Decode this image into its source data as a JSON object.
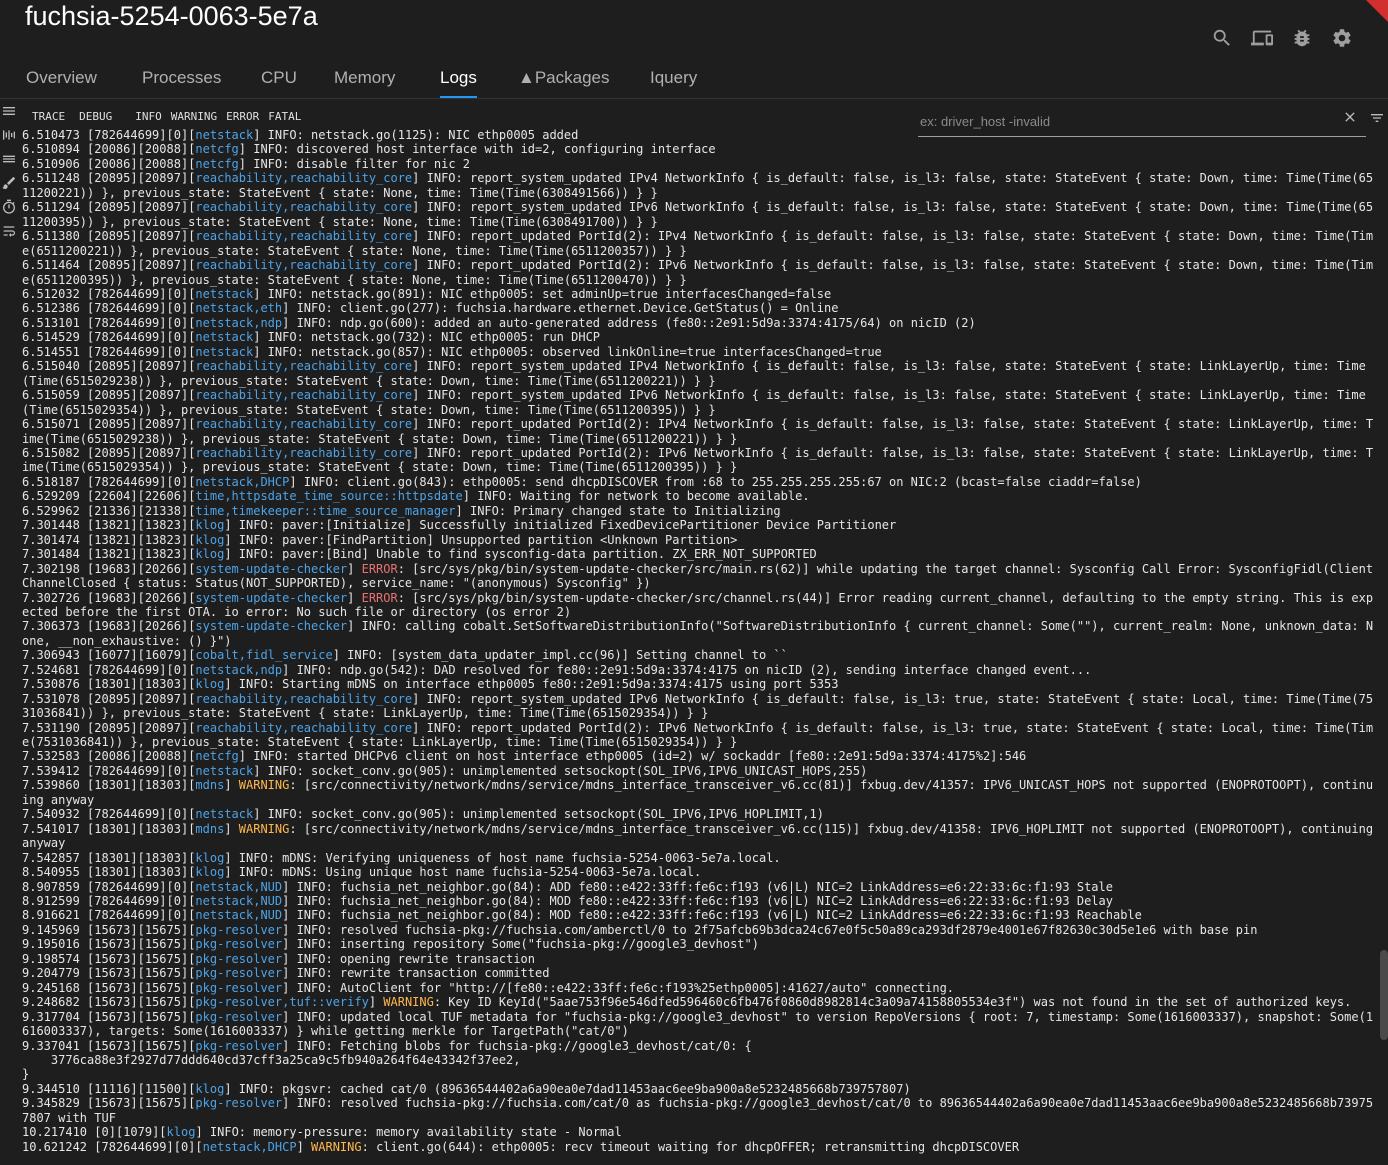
{
  "window": {
    "title": "fuchsia-5254-0063-5e7a"
  },
  "toolbar": {
    "icons": [
      "search-icon",
      "devices-icon",
      "bug-icon",
      "settings-icon"
    ]
  },
  "tabs": [
    {
      "label": "Overview",
      "active": false
    },
    {
      "label": "Processes",
      "active": false
    },
    {
      "label": "CPU",
      "active": false
    },
    {
      "label": "Memory",
      "active": false
    },
    {
      "label": "Logs",
      "active": true
    },
    {
      "label": "Packages",
      "active": false
    },
    {
      "label": "Iquery",
      "active": false
    }
  ],
  "levels": [
    "TRACE",
    "DEBUG",
    "INFO",
    "WARNING",
    "ERROR",
    "FATAL"
  ],
  "filter": {
    "placeholder": "ex: driver_host -invalid",
    "value": ""
  },
  "colors": {
    "tag": "#4da3e8",
    "error": "#e57373",
    "warning": "#ffb74d",
    "accent": "#2196f3"
  },
  "logs": [
    {
      "ts": "6.510473",
      "pid": "[782644699][0]",
      "tags": "netstack",
      "level": "INFO",
      "msg": " netstack.go(1125): NIC ethp0005 added"
    },
    {
      "ts": "6.510894",
      "pid": "[20086][20088]",
      "tags": "netcfg",
      "level": "INFO",
      "msg": " discovered host interface with id=2, configuring interface"
    },
    {
      "ts": "6.510906",
      "pid": "[20086][20088]",
      "tags": "netcfg",
      "level": "INFO",
      "msg": " disable filter for nic 2"
    },
    {
      "ts": "6.511248",
      "pid": "[20895][20897]",
      "tags": "reachability,reachability_core",
      "level": "INFO",
      "msg": " report_system_updated IPv4 NetworkInfo { is_default: false, is_l3: false, state: StateEvent { state: Down, time: Time(Time(6511200221)) }, previous_state: StateEvent { state: None, time: Time(Time(6308491566)) } }"
    },
    {
      "ts": "6.511294",
      "pid": "[20895][20897]",
      "tags": "reachability,reachability_core",
      "level": "INFO",
      "msg": " report_system_updated IPv6 NetworkInfo { is_default: false, is_l3: false, state: StateEvent { state: Down, time: Time(Time(6511200395)) }, previous_state: StateEvent { state: None, time: Time(Time(6308491700)) } }"
    },
    {
      "ts": "6.511380",
      "pid": "[20895][20897]",
      "tags": "reachability,reachability_core",
      "level": "INFO",
      "msg": " report_updated PortId(2): IPv4 NetworkInfo { is_default: false, is_l3: false, state: StateEvent { state: Down, time: Time(Time(6511200221)) }, previous_state: StateEvent { state: None, time: Time(Time(6511200357)) } }"
    },
    {
      "ts": "6.511464",
      "pid": "[20895][20897]",
      "tags": "reachability,reachability_core",
      "level": "INFO",
      "msg": " report_updated PortId(2): IPv6 NetworkInfo { is_default: false, is_l3: false, state: StateEvent { state: Down, time: Time(Time(6511200395)) }, previous_state: StateEvent { state: None, time: Time(Time(6511200470)) } }"
    },
    {
      "ts": "6.512032",
      "pid": "[782644699][0]",
      "tags": "netstack",
      "level": "INFO",
      "msg": " netstack.go(891): NIC ethp0005: set adminUp=true interfacesChanged=false"
    },
    {
      "ts": "6.512386",
      "pid": "[782644699][0]",
      "tags": "netstack,eth",
      "level": "INFO",
      "msg": " client.go(277): fuchsia.hardware.ethernet.Device.GetStatus() = Online"
    },
    {
      "ts": "6.513101",
      "pid": "[782644699][0]",
      "tags": "netstack,ndp",
      "level": "INFO",
      "msg": " ndp.go(600): added an auto-generated address (fe80::2e91:5d9a:3374:4175/64) on nicID (2)"
    },
    {
      "ts": "6.514529",
      "pid": "[782644699][0]",
      "tags": "netstack",
      "level": "INFO",
      "msg": " netstack.go(732): NIC ethp0005: run DHCP"
    },
    {
      "ts": "6.514551",
      "pid": "[782644699][0]",
      "tags": "netstack",
      "level": "INFO",
      "msg": " netstack.go(857): NIC ethp0005: observed linkOnline=true interfacesChanged=true"
    },
    {
      "ts": "6.515040",
      "pid": "[20895][20897]",
      "tags": "reachability,reachability_core",
      "level": "INFO",
      "msg": " report_system_updated IPv4 NetworkInfo { is_default: false, is_l3: false, state: StateEvent { state: LinkLayerUp, time: Time(Time(6515029238)) }, previous_state: StateEvent { state: Down, time: Time(Time(6511200221)) } }"
    },
    {
      "ts": "6.515059",
      "pid": "[20895][20897]",
      "tags": "reachability,reachability_core",
      "level": "INFO",
      "msg": " report_system_updated IPv6 NetworkInfo { is_default: false, is_l3: false, state: StateEvent { state: LinkLayerUp, time: Time(Time(6515029354)) }, previous_state: StateEvent { state: Down, time: Time(Time(6511200395)) } }"
    },
    {
      "ts": "6.515071",
      "pid": "[20895][20897]",
      "tags": "reachability,reachability_core",
      "level": "INFO",
      "msg": " report_updated PortId(2): IPv4 NetworkInfo { is_default: false, is_l3: false, state: StateEvent { state: LinkLayerUp, time: Time(Time(6515029238)) }, previous_state: StateEvent { state: Down, time: Time(Time(6511200221)) } }"
    },
    {
      "ts": "6.515082",
      "pid": "[20895][20897]",
      "tags": "reachability,reachability_core",
      "level": "INFO",
      "msg": " report_updated PortId(2): IPv6 NetworkInfo { is_default: false, is_l3: false, state: StateEvent { state: LinkLayerUp, time: Time(Time(6515029354)) }, previous_state: StateEvent { state: Down, time: Time(Time(6511200395)) } }"
    },
    {
      "ts": "6.518187",
      "pid": "[782644699][0]",
      "tags": "netstack,DHCP",
      "level": "INFO",
      "msg": " client.go(843): ethp0005: send dhcpDISCOVER from :68 to 255.255.255.255:67 on NIC:2 (bcast=false ciaddr=false)"
    },
    {
      "ts": "6.529209",
      "pid": "[22604][22606]",
      "tags": "time,httpsdate_time_source::httpsdate",
      "level": "INFO",
      "msg": " Waiting for network to become available."
    },
    {
      "ts": "6.529962",
      "pid": "[21336][21338]",
      "tags": "time,timekeeper::time_source_manager",
      "level": "INFO",
      "msg": " Primary changed state to Initializing"
    },
    {
      "ts": "7.301448",
      "pid": "[13821][13823]",
      "tags": "klog",
      "level": "INFO",
      "msg": " paver:[Initialize] Successfully initialized FixedDevicePartitioner Device Partitioner"
    },
    {
      "ts": "7.301474",
      "pid": "[13821][13823]",
      "tags": "klog",
      "level": "INFO",
      "msg": " paver:[FindPartition] Unsupported partition <Unknown Partition>"
    },
    {
      "ts": "7.301484",
      "pid": "[13821][13823]",
      "tags": "klog",
      "level": "INFO",
      "msg": " paver:[Bind] Unable to find sysconfig-data partition. ZX_ERR_NOT_SUPPORTED"
    },
    {
      "ts": "7.302198",
      "pid": "[19683][20266]",
      "tags": "system-update-checker",
      "level": "ERROR",
      "msg": " [src/sys/pkg/bin/system-update-checker/src/main.rs(62)] while updating the target channel: Sysconfig Call Error: SysconfigFidl(ClientChannelClosed { status: Status(NOT_SUPPORTED), service_name: \"(anonymous) Sysconfig\" })"
    },
    {
      "ts": "7.302726",
      "pid": "[19683][20266]",
      "tags": "system-update-checker",
      "level": "ERROR",
      "msg": " [src/sys/pkg/bin/system-update-checker/src/channel.rs(44)] Error reading current_channel, defaulting to the empty string. This is expected before the first OTA. io error: No such file or directory (os error 2)"
    },
    {
      "ts": "7.306373",
      "pid": "[19683][20266]",
      "tags": "system-update-checker",
      "level": "INFO",
      "msg": " calling cobalt.SetSoftwareDistributionInfo(\"SoftwareDistributionInfo { current_channel: Some(\"\"), current_realm: None, unknown_data: None, __non_exhaustive: () }\")"
    },
    {
      "ts": "7.306943",
      "pid": "[16077][16079]",
      "tags": "cobalt,fidl_service",
      "level": "INFO",
      "msg": " [system_data_updater_impl.cc(96)] Setting channel to ``"
    },
    {
      "ts": "7.524681",
      "pid": "[782644699][0]",
      "tags": "netstack,ndp",
      "level": "INFO",
      "msg": " ndp.go(542): DAD resolved for fe80::2e91:5d9a:3374:4175 on nicID (2), sending interface changed event..."
    },
    {
      "ts": "7.530876",
      "pid": "[18301][18303]",
      "tags": "klog",
      "level": "INFO",
      "msg": " Starting mDNS on interface ethp0005 fe80::2e91:5d9a:3374:4175 using port 5353"
    },
    {
      "ts": "7.531078",
      "pid": "[20895][20897]",
      "tags": "reachability,reachability_core",
      "level": "INFO",
      "msg": " report_system_updated IPv6 NetworkInfo { is_default: false, is_l3: true, state: StateEvent { state: Local, time: Time(Time(7531036841)) }, previous_state: StateEvent { state: LinkLayerUp, time: Time(Time(6515029354)) } }"
    },
    {
      "ts": "7.531190",
      "pid": "[20895][20897]",
      "tags": "reachability,reachability_core",
      "level": "INFO",
      "msg": " report_updated PortId(2): IPv6 NetworkInfo { is_default: false, is_l3: true, state: StateEvent { state: Local, time: Time(Time(7531036841)) }, previous_state: StateEvent { state: LinkLayerUp, time: Time(Time(6515029354)) } }"
    },
    {
      "ts": "7.532583",
      "pid": "[20086][20088]",
      "tags": "netcfg",
      "level": "INFO",
      "msg": " started DHCPv6 client on host interface ethp0005 (id=2) w/ sockaddr [fe80::2e91:5d9a:3374:4175%2]:546"
    },
    {
      "ts": "7.539412",
      "pid": "[782644699][0]",
      "tags": "netstack",
      "level": "INFO",
      "msg": " socket_conv.go(905): unimplemented setsockopt(SOL_IPV6,IPV6_UNICAST_HOPS,255)"
    },
    {
      "ts": "7.539860",
      "pid": "[18301][18303]",
      "tags": "mdns",
      "level": "WARNING",
      "msg": " [src/connectivity/network/mdns/service/mdns_interface_transceiver_v6.cc(81)] fxbug.dev/41357: IPV6_UNICAST_HOPS not supported (ENOPROTOOPT), continuing anyway"
    },
    {
      "ts": "7.540932",
      "pid": "[782644699][0]",
      "tags": "netstack",
      "level": "INFO",
      "msg": " socket_conv.go(905): unimplemented setsockopt(SOL_IPV6,IPV6_HOPLIMIT,1)"
    },
    {
      "ts": "7.541017",
      "pid": "[18301][18303]",
      "tags": "mdns",
      "level": "WARNING",
      "msg": " [src/connectivity/network/mdns/service/mdns_interface_transceiver_v6.cc(115)] fxbug.dev/41358: IPV6_HOPLIMIT not supported (ENOPROTOOPT), continuing anyway"
    },
    {
      "ts": "7.542857",
      "pid": "[18301][18303]",
      "tags": "klog",
      "level": "INFO",
      "msg": " mDNS: Verifying uniqueness of host name fuchsia-5254-0063-5e7a.local."
    },
    {
      "ts": "8.540955",
      "pid": "[18301][18303]",
      "tags": "klog",
      "level": "INFO",
      "msg": " mDNS: Using unique host name fuchsia-5254-0063-5e7a.local."
    },
    {
      "ts": "8.907859",
      "pid": "[782644699][0]",
      "tags": "netstack,NUD",
      "level": "INFO",
      "msg": " fuchsia_net_neighbor.go(84): ADD fe80::e422:33ff:fe6c:f193 (v6|L) NIC=2 LinkAddress=e6:22:33:6c:f1:93 Stale"
    },
    {
      "ts": "8.912599",
      "pid": "[782644699][0]",
      "tags": "netstack,NUD",
      "level": "INFO",
      "msg": " fuchsia_net_neighbor.go(84): MOD fe80::e422:33ff:fe6c:f193 (v6|L) NIC=2 LinkAddress=e6:22:33:6c:f1:93 Delay"
    },
    {
      "ts": "8.916621",
      "pid": "[782644699][0]",
      "tags": "netstack,NUD",
      "level": "INFO",
      "msg": " fuchsia_net_neighbor.go(84): MOD fe80::e422:33ff:fe6c:f193 (v6|L) NIC=2 LinkAddress=e6:22:33:6c:f1:93 Reachable"
    },
    {
      "ts": "9.145969",
      "pid": "[15673][15675]",
      "tags": "pkg-resolver",
      "level": "INFO",
      "msg": " resolved fuchsia-pkg://fuchsia.com/amberctl/0 to 2f75afcb69b3dca24c67e0f5c50a89ca293df2879e4001e67f82630c30d5e1e6 with base pin"
    },
    {
      "ts": "9.195016",
      "pid": "[15673][15675]",
      "tags": "pkg-resolver",
      "level": "INFO",
      "msg": " inserting repository Some(\"fuchsia-pkg://google3_devhost\")"
    },
    {
      "ts": "9.198574",
      "pid": "[15673][15675]",
      "tags": "pkg-resolver",
      "level": "INFO",
      "msg": " opening rewrite transaction"
    },
    {
      "ts": "9.204779",
      "pid": "[15673][15675]",
      "tags": "pkg-resolver",
      "level": "INFO",
      "msg": " rewrite transaction committed"
    },
    {
      "ts": "9.245168",
      "pid": "[15673][15675]",
      "tags": "pkg-resolver",
      "level": "INFO",
      "msg": " AutoClient for \"http://[fe80::e422:33ff:fe6c:f193%25ethp0005]:41627/auto\" connecting."
    },
    {
      "ts": "9.248682",
      "pid": "[15673][15675]",
      "tags": "pkg-resolver,tuf::verify",
      "level": "WARNING",
      "msg": " Key ID KeyId(\"5aae753f96e546dfed596460c6fb476f0860d8982814c3a09a74158805534e3f\") was not found in the set of authorized keys."
    },
    {
      "ts": "9.317704",
      "pid": "[15673][15675]",
      "tags": "pkg-resolver",
      "level": "INFO",
      "msg": " updated local TUF metadata for \"fuchsia-pkg://google3_devhost\" to version RepoVersions { root: 7, timestamp: Some(1616003337), snapshot: Some(1616003337), targets: Some(1616003337) } while getting merkle for TargetPath(\"cat/0\")"
    },
    {
      "ts": "9.337041",
      "pid": "[15673][15675]",
      "tags": "pkg-resolver",
      "level": "INFO",
      "msg": " Fetching blobs for fuchsia-pkg://google3_devhost/cat/0: {\n    3776ca88e3f2927d77ddd640cd37cff3a25ca9c5fb940a264f64e43342f37ee2,\n}"
    },
    {
      "ts": "9.344510",
      "pid": "[11116][11500]",
      "tags": "klog",
      "level": "INFO",
      "msg": " pkgsvr: cached cat/0 (89636544402a6a90ea0e7dad11453aac6ee9ba900a8e5232485668b739757807)"
    },
    {
      "ts": "9.345829",
      "pid": "[15673][15675]",
      "tags": "pkg-resolver",
      "level": "INFO",
      "msg": " resolved fuchsia-pkg://fuchsia.com/cat/0 as fuchsia-pkg://google3_devhost/cat/0 to 89636544402a6a90ea0e7dad11453aac6ee9ba900a8e5232485668b739757807 with TUF"
    },
    {
      "ts": "10.217410",
      "pid": "[0][1079]",
      "tags": "klog",
      "level": "INFO",
      "msg": " memory-pressure: memory availability state - Normal"
    },
    {
      "ts": "10.621242",
      "pid": "[782644699][0]",
      "tags": "netstack,DHCP",
      "level": "WARNING",
      "msg": " client.go(644): ethp0005: recv timeout waiting for dhcpOFFER; retransmitting dhcpDISCOVER"
    }
  ]
}
